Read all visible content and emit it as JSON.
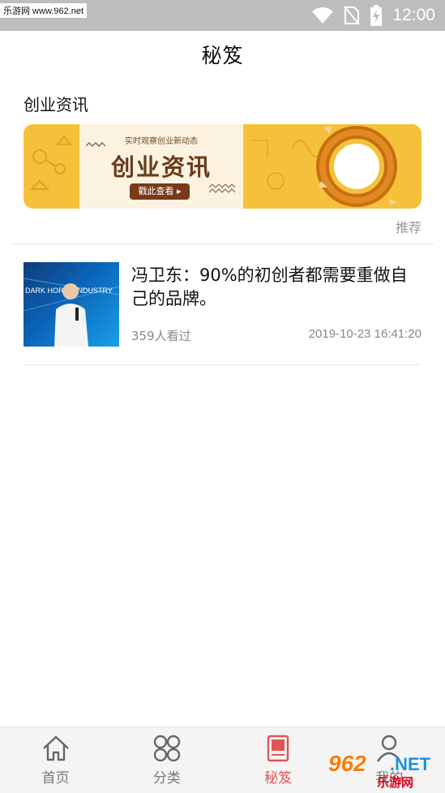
{
  "status_bar": {
    "watermark": "乐游网 www.962.net",
    "time": "12:00",
    "icons": [
      "wifi-icon",
      "no-sim-icon",
      "battery-charging-icon"
    ]
  },
  "header": {
    "title": "秘笈"
  },
  "section": {
    "title": "创业资讯"
  },
  "banner": {
    "subtitle": "实时观察创业新动态",
    "title": "创业资讯",
    "button": "戳此查看 ▸",
    "colors": {
      "background": "#f6c13a",
      "center": "#fbf3e0",
      "title": "#6a3b1b",
      "button": "#7a3a1a"
    }
  },
  "recommend_label": "推荐",
  "articles": [
    {
      "title": "冯卫东：90%的初创者都需要重做自己的品牌。",
      "views": "359人看过",
      "date": "2019-10-23 16:41:20",
      "thumb_text": "DARK HORSE INDUSTRY"
    }
  ],
  "bottom_nav": [
    {
      "label": "首页",
      "icon": "home-icon",
      "active": false
    },
    {
      "label": "分类",
      "icon": "category-grid-icon",
      "active": false
    },
    {
      "label": "秘笈",
      "icon": "book-icon",
      "active": true
    },
    {
      "label": "我的",
      "icon": "user-icon",
      "active": false
    }
  ],
  "bottom_watermark": {
    "num": "962",
    "net": ".NET",
    "cn": "乐游网"
  },
  "accent_color": "#e05555"
}
